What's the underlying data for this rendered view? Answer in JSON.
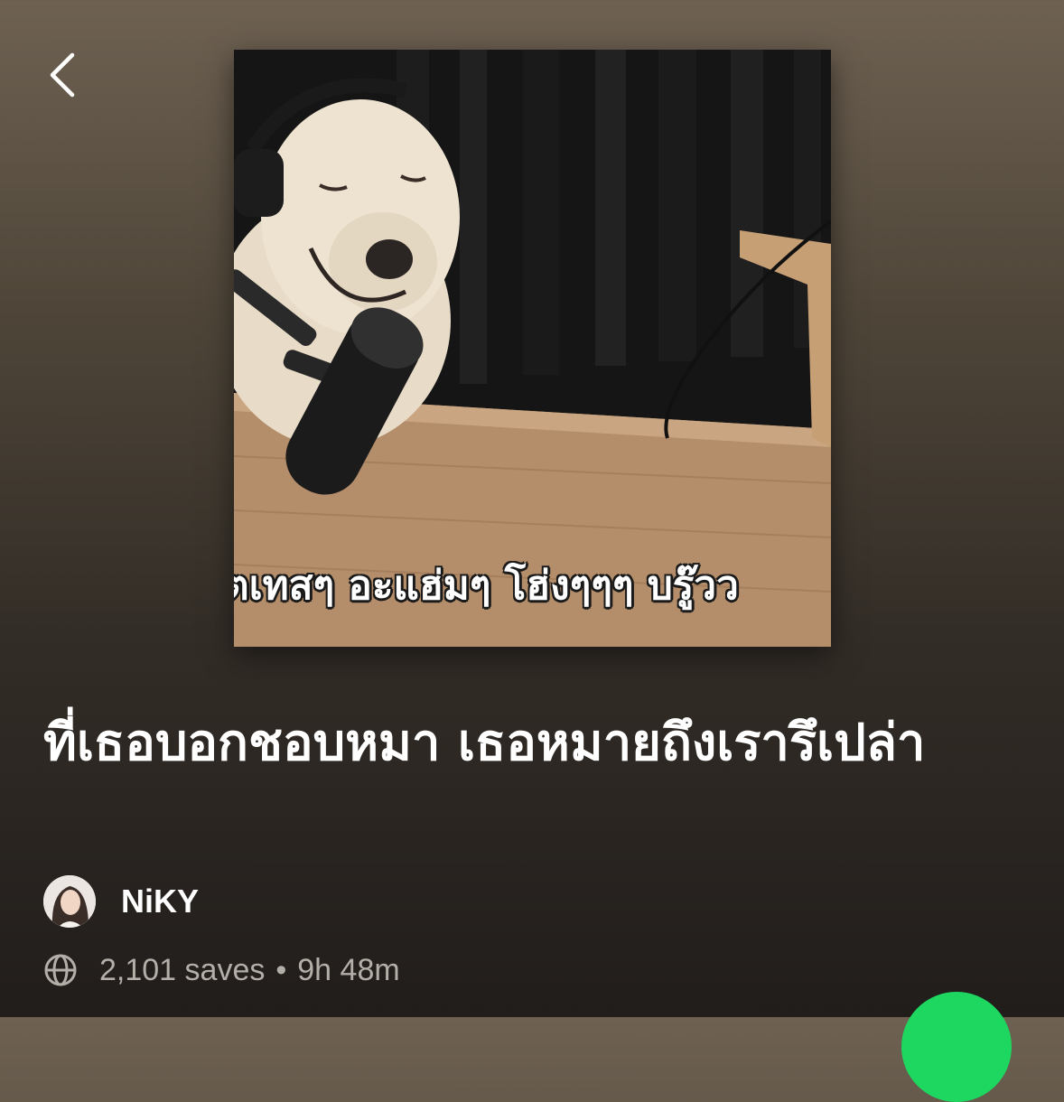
{
  "header": {
    "back_icon": "chevron-left-icon"
  },
  "cover": {
    "caption": "ตเทสๆ อะแฮ่มๆ โฮ่งๆๆๆ บรู๊วว"
  },
  "playlist": {
    "title": "ที่เธอบอกชอบหมา เธอหมายถึงเรารึเปล่า",
    "owner_name": "NiKY",
    "saves": "2,101 saves",
    "separator": "•",
    "duration": "9h 48m"
  },
  "colors": {
    "accent": "#1ed760",
    "background_top": "#6e6152",
    "background_bottom": "#211d1b",
    "meta_text": "#b3aea8"
  },
  "icons": {
    "meta": "globe-icon",
    "play": "play-button"
  }
}
